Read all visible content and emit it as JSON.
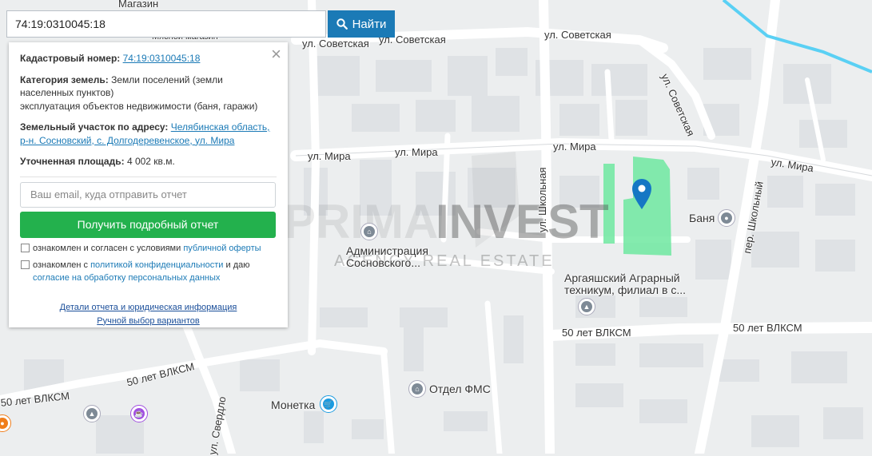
{
  "search": {
    "value": "74:19:0310045:18",
    "button_label": "Найти"
  },
  "panel": {
    "cadastral_label": "Кадастровый номер:",
    "cadastral_value": "74:19:0310045:18",
    "category_label": "Категория земель:",
    "category_value_1": "Земли поселений (земли",
    "category_value_2": "населенных пунктов)",
    "category_value_3": "эксплуатация объектов недвижимости (баня, гаражи)",
    "address_label": "Земельный участок по адресу:",
    "address_value_1": "Челябинская область,",
    "address_value_2": "р-н. Сосновский, с. Долгодеревенское, ул. Мира",
    "area_label": "Уточненная площадь:",
    "area_value": "4 002 кв.м.",
    "email_placeholder": "Ваш email, куда отправить отчет",
    "report_button": "Получить подробный отчет",
    "consent1_text": "ознакомлен и согласен с условиями",
    "consent1_link": "публичной оферты",
    "consent2_text": "ознакомлен с",
    "consent2_link": "политикой конфиденциальности",
    "consent2_text_2": "и даю",
    "consent2_link_2": "согласие на обработку персональных данных",
    "details_link": "Детали отчета и юридическая информация",
    "manual_link": "Ручной выбор вариантов"
  },
  "map": {
    "streets": {
      "sovetskaya_1": "ул. Советская",
      "sovetskaya_2": "ул. Советская",
      "sovetskaya_3": "ул. Советская",
      "sovetskaya_v": "ул. Советская",
      "mira_1": "ул. Мира",
      "mira_2": "ул. Мира",
      "mira_3": "ул. Мира",
      "mira_4": "ул. Мира",
      "shkolnaya_v": "ул. Школьная",
      "per_shkolny": "пер. Школьный",
      "vlksm_1": "50 лет ВЛКСМ",
      "vlksm_2": "50 лет ВЛКСМ",
      "vlksm_3": "50 лет ВЛКСМ",
      "vlksm_4": "50 лет ВЛКСМ",
      "sverdl": "ул. Свердло"
    },
    "poi": {
      "magazin": "Магазин",
      "myasnoy": "Мясной магазин",
      "admin_1": "Администрация",
      "admin_2": "Сосновского...",
      "tech_1": "Аргаяшский Аграрный",
      "tech_2": "техникум, филиал в с...",
      "banya": "Баня",
      "moneta": "Монетка",
      "fms": "Отдел ФМС"
    },
    "watermark": {
      "prima": "PRIMA",
      "invest": "INVEST",
      "sub": "AGENCY REAL ESTATE"
    },
    "colors": {
      "parcel": "#6fe8a0",
      "pin": "#1577c4",
      "accent": "#1b7ab6",
      "button": "#23b14d",
      "river": "#5ad0f4"
    }
  }
}
